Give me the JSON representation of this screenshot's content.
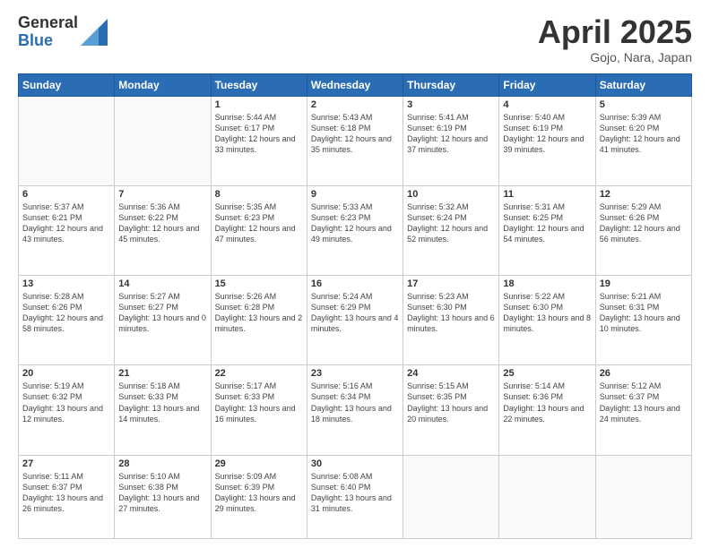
{
  "header": {
    "logo_general": "General",
    "logo_blue": "Blue",
    "title": "April 2025",
    "location": "Gojo, Nara, Japan"
  },
  "days_of_week": [
    "Sunday",
    "Monday",
    "Tuesday",
    "Wednesday",
    "Thursday",
    "Friday",
    "Saturday"
  ],
  "weeks": [
    [
      {
        "day": "",
        "info": ""
      },
      {
        "day": "",
        "info": ""
      },
      {
        "day": "1",
        "info": "Sunrise: 5:44 AM\nSunset: 6:17 PM\nDaylight: 12 hours and 33 minutes."
      },
      {
        "day": "2",
        "info": "Sunrise: 5:43 AM\nSunset: 6:18 PM\nDaylight: 12 hours and 35 minutes."
      },
      {
        "day": "3",
        "info": "Sunrise: 5:41 AM\nSunset: 6:19 PM\nDaylight: 12 hours and 37 minutes."
      },
      {
        "day": "4",
        "info": "Sunrise: 5:40 AM\nSunset: 6:19 PM\nDaylight: 12 hours and 39 minutes."
      },
      {
        "day": "5",
        "info": "Sunrise: 5:39 AM\nSunset: 6:20 PM\nDaylight: 12 hours and 41 minutes."
      }
    ],
    [
      {
        "day": "6",
        "info": "Sunrise: 5:37 AM\nSunset: 6:21 PM\nDaylight: 12 hours and 43 minutes."
      },
      {
        "day": "7",
        "info": "Sunrise: 5:36 AM\nSunset: 6:22 PM\nDaylight: 12 hours and 45 minutes."
      },
      {
        "day": "8",
        "info": "Sunrise: 5:35 AM\nSunset: 6:23 PM\nDaylight: 12 hours and 47 minutes."
      },
      {
        "day": "9",
        "info": "Sunrise: 5:33 AM\nSunset: 6:23 PM\nDaylight: 12 hours and 49 minutes."
      },
      {
        "day": "10",
        "info": "Sunrise: 5:32 AM\nSunset: 6:24 PM\nDaylight: 12 hours and 52 minutes."
      },
      {
        "day": "11",
        "info": "Sunrise: 5:31 AM\nSunset: 6:25 PM\nDaylight: 12 hours and 54 minutes."
      },
      {
        "day": "12",
        "info": "Sunrise: 5:29 AM\nSunset: 6:26 PM\nDaylight: 12 hours and 56 minutes."
      }
    ],
    [
      {
        "day": "13",
        "info": "Sunrise: 5:28 AM\nSunset: 6:26 PM\nDaylight: 12 hours and 58 minutes."
      },
      {
        "day": "14",
        "info": "Sunrise: 5:27 AM\nSunset: 6:27 PM\nDaylight: 13 hours and 0 minutes."
      },
      {
        "day": "15",
        "info": "Sunrise: 5:26 AM\nSunset: 6:28 PM\nDaylight: 13 hours and 2 minutes."
      },
      {
        "day": "16",
        "info": "Sunrise: 5:24 AM\nSunset: 6:29 PM\nDaylight: 13 hours and 4 minutes."
      },
      {
        "day": "17",
        "info": "Sunrise: 5:23 AM\nSunset: 6:30 PM\nDaylight: 13 hours and 6 minutes."
      },
      {
        "day": "18",
        "info": "Sunrise: 5:22 AM\nSunset: 6:30 PM\nDaylight: 13 hours and 8 minutes."
      },
      {
        "day": "19",
        "info": "Sunrise: 5:21 AM\nSunset: 6:31 PM\nDaylight: 13 hours and 10 minutes."
      }
    ],
    [
      {
        "day": "20",
        "info": "Sunrise: 5:19 AM\nSunset: 6:32 PM\nDaylight: 13 hours and 12 minutes."
      },
      {
        "day": "21",
        "info": "Sunrise: 5:18 AM\nSunset: 6:33 PM\nDaylight: 13 hours and 14 minutes."
      },
      {
        "day": "22",
        "info": "Sunrise: 5:17 AM\nSunset: 6:33 PM\nDaylight: 13 hours and 16 minutes."
      },
      {
        "day": "23",
        "info": "Sunrise: 5:16 AM\nSunset: 6:34 PM\nDaylight: 13 hours and 18 minutes."
      },
      {
        "day": "24",
        "info": "Sunrise: 5:15 AM\nSunset: 6:35 PM\nDaylight: 13 hours and 20 minutes."
      },
      {
        "day": "25",
        "info": "Sunrise: 5:14 AM\nSunset: 6:36 PM\nDaylight: 13 hours and 22 minutes."
      },
      {
        "day": "26",
        "info": "Sunrise: 5:12 AM\nSunset: 6:37 PM\nDaylight: 13 hours and 24 minutes."
      }
    ],
    [
      {
        "day": "27",
        "info": "Sunrise: 5:11 AM\nSunset: 6:37 PM\nDaylight: 13 hours and 26 minutes."
      },
      {
        "day": "28",
        "info": "Sunrise: 5:10 AM\nSunset: 6:38 PM\nDaylight: 13 hours and 27 minutes."
      },
      {
        "day": "29",
        "info": "Sunrise: 5:09 AM\nSunset: 6:39 PM\nDaylight: 13 hours and 29 minutes."
      },
      {
        "day": "30",
        "info": "Sunrise: 5:08 AM\nSunset: 6:40 PM\nDaylight: 13 hours and 31 minutes."
      },
      {
        "day": "",
        "info": ""
      },
      {
        "day": "",
        "info": ""
      },
      {
        "day": "",
        "info": ""
      }
    ]
  ]
}
